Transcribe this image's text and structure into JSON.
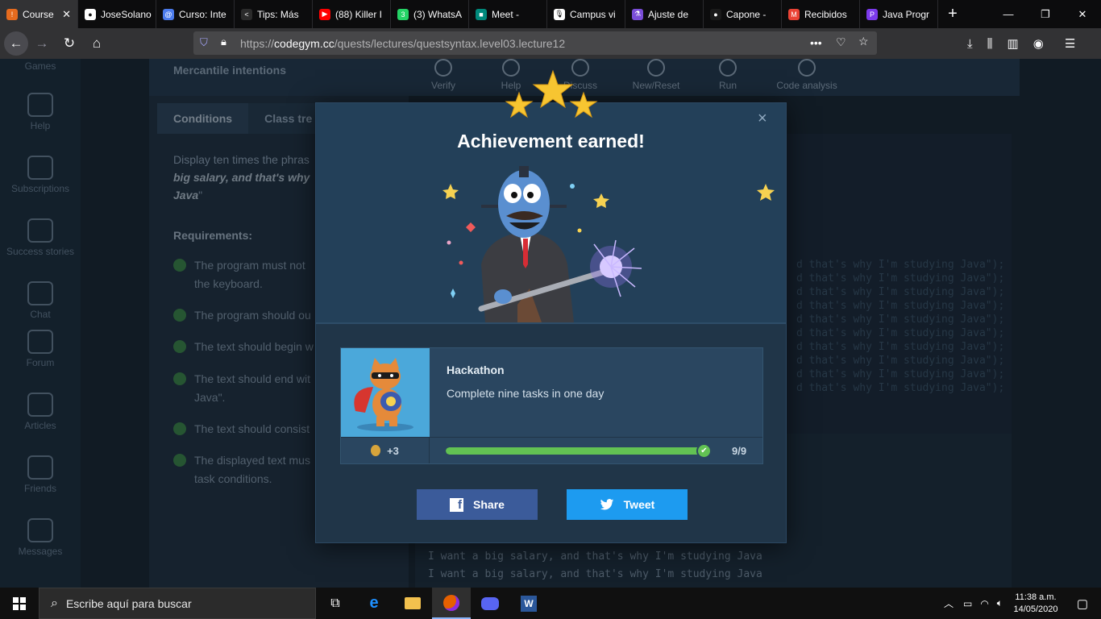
{
  "browser": {
    "tabs": [
      {
        "label": "Course",
        "color": "#e66b1e",
        "glyph": "!",
        "active": true
      },
      {
        "label": "JoseSolano",
        "color": "#ffffff",
        "glyph": "●"
      },
      {
        "label": "Curso: Inte",
        "color": "#4b7bec",
        "glyph": "@"
      },
      {
        "label": "Tips: Más",
        "color": "#2b2b2b",
        "glyph": "<"
      },
      {
        "label": "(88) Killer I",
        "color": "#ff0000",
        "glyph": "▶"
      },
      {
        "label": "(3) WhatsA",
        "color": "#25d366",
        "glyph": "3"
      },
      {
        "label": "Meet -",
        "color": "#00897b",
        "glyph": "■"
      },
      {
        "label": "Campus vi",
        "color": "#ffffff",
        "glyph": "🎙"
      },
      {
        "label": "Ajuste de",
        "color": "#7a4dd8",
        "glyph": "⚗"
      },
      {
        "label": "Capone -",
        "color": "#1a1a1a",
        "glyph": "●"
      },
      {
        "label": "Recibidos",
        "color": "#ea4335",
        "glyph": "M"
      },
      {
        "label": "Java Progr",
        "color": "#7c3aed",
        "glyph": "P"
      }
    ],
    "url_prefix": "https://",
    "url_domain": "codegym.cc",
    "url_path": "/quests/lectures/questsyntax.level03.lecture12",
    "url_more": "•••"
  },
  "sidebar": {
    "items": [
      {
        "label": "Games"
      },
      {
        "label": "Help"
      },
      {
        "label": "Subscriptions"
      },
      {
        "label": "Success stories"
      },
      {
        "label": "Chat"
      },
      {
        "label": "Forum"
      },
      {
        "label": "Articles"
      },
      {
        "label": "Friends"
      },
      {
        "label": "Messages"
      }
    ]
  },
  "lesson": {
    "title": "Mercantile intentions",
    "toolbar": [
      {
        "label": "Verify"
      },
      {
        "label": "Help"
      },
      {
        "label": "Discuss"
      },
      {
        "label": "New/Reset"
      },
      {
        "label": "Run"
      },
      {
        "label": "Code analysis"
      }
    ],
    "tabs": [
      {
        "label": "Conditions"
      },
      {
        "label": "Class tre"
      }
    ],
    "desc_plain": "Display ten times the phras",
    "desc_bold": "big salary, and that's why",
    "desc_end": "Java",
    "requirements_title": "Requirements:",
    "requirements": [
      "The program must not",
      "the keyboard.",
      "The program should ou",
      "The text should begin w",
      "The text should end wit",
      "Java\".",
      "The text should consist",
      "The displayed text mus",
      "task conditions."
    ],
    "code_line": "d that's why I'm studying Java\");",
    "code_line_last": "d that's why I'm studying Java\");",
    "output_line": "I want a big salary, and that's why I'm studying Java"
  },
  "modal": {
    "title": "Achievement earned!",
    "close": "×",
    "achievement": {
      "name": "Hackathon",
      "description": "Complete nine tasks in one day",
      "points": "+3",
      "progress_label": "9/9",
      "progress_fraction": 1.0
    },
    "share_label": "Share",
    "tweet_label": "Tweet"
  },
  "taskbar": {
    "search_placeholder": "Escribe aquí para buscar",
    "time": "11:38 a.m.",
    "date": "14/05/2020"
  }
}
